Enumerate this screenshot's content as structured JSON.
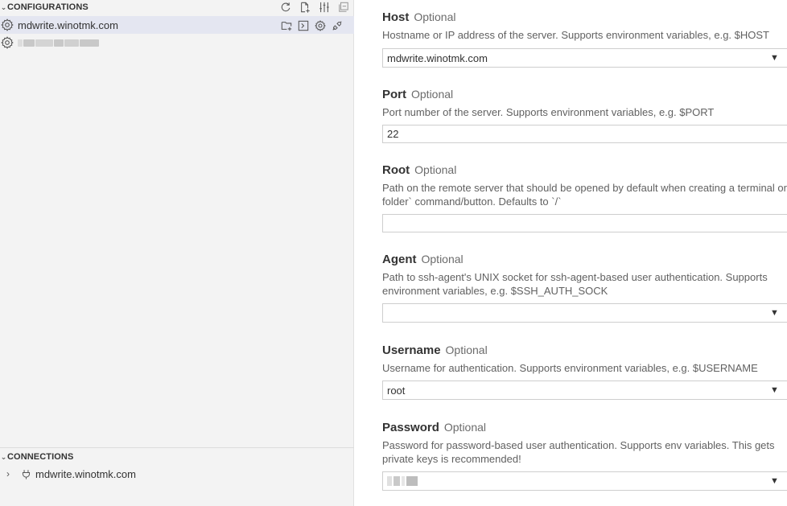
{
  "sidebar": {
    "configurations_header": "CONFIGURATIONS",
    "configurations": [
      {
        "label": "mdwrite.winotmk.com",
        "selected": true
      },
      {
        "label": "",
        "redacted": true,
        "selected": false
      }
    ],
    "connections_header": "CONNECTIONS",
    "connections": [
      {
        "label": "mdwrite.winotmk.com"
      }
    ],
    "header_actions": [
      "refresh-icon",
      "new-file-icon",
      "settings-sliders-icon",
      "collapse-all-icon"
    ],
    "row_actions": [
      "new-folder-icon",
      "terminal-icon",
      "gear-icon",
      "connect-plug-icon"
    ]
  },
  "fields": {
    "host": {
      "name": "Host",
      "optional": "Optional",
      "desc": "Hostname or IP address of the server. Supports environment variables, e.g. $HOST",
      "value": "mdwrite.winotmk.com"
    },
    "port": {
      "name": "Port",
      "optional": "Optional",
      "desc": "Port number of the server. Supports environment variables, e.g. $PORT",
      "value": "22"
    },
    "root": {
      "name": "Root",
      "optional": "Optional",
      "desc1": "Path on the remote server that should be opened by default when creating a terminal or using the `Add as Workspace",
      "desc2": "folder` command/button. Defaults to `/`",
      "value": ""
    },
    "agent": {
      "name": "Agent",
      "optional": "Optional",
      "desc1": "Path to ssh-agent's UNIX socket for ssh-agent-based user authentication. Supports",
      "desc2": "environment variables, e.g. $SSH_AUTH_SOCK",
      "value": ""
    },
    "username": {
      "name": "Username",
      "optional": "Optional",
      "desc": "Username for authentication. Supports environment variables, e.g. $USERNAME",
      "value": "root"
    },
    "password": {
      "name": "Password",
      "optional": "Optional",
      "desc1": "Password for password-based user authentication. Supports env variables. This gets",
      "desc2": "private keys is recommended!",
      "value": ""
    }
  }
}
